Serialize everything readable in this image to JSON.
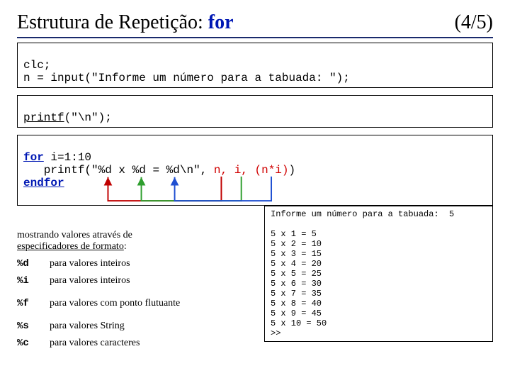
{
  "header": {
    "title_pre": "Estrutura de Repetição: ",
    "title_kw": "for",
    "pager": "(4/5)"
  },
  "code1": {
    "line1": "clc;",
    "line2": "n = input(\"Informe um número para a tabuada: \");"
  },
  "code2": {
    "line1a": "printf",
    "line1b": "(\"\\n\");"
  },
  "code3": {
    "kw_for": "for",
    "for_rest": " i=1:10",
    "pf1": "   printf(",
    "fmt_q1": "\"",
    "fmt_d1": "%d",
    "fmt_x": " x ",
    "fmt_d2": "%d",
    "fmt_eq": " = ",
    "fmt_d3": "%d",
    "fmt_tail": "\\n\"",
    "comma_sp": ", ",
    "arg_n": "n,",
    "sp": " ",
    "arg_i": "i,",
    "arg_ni": "(n*i)",
    "pf_close": ")",
    "kw_end": "endfor"
  },
  "notes": {
    "intro1": "mostrando valores através de",
    "intro2": "especificadores de formato",
    "colon": ":",
    "d": "%d",
    "d_desc": "para valores inteiros",
    "i": "%i",
    "i_desc": "para valores inteiros",
    "f": "%f",
    "f_desc": "para valores com ponto flutuante",
    "s": "%s",
    "s_desc": "para valores String",
    "c": "%c",
    "c_desc": "para valores caracteres"
  },
  "output": {
    "prompt": "Informe um número para a tabuada:  5",
    "lines": [
      "5 x 1 = 5",
      "5 x 2 = 10",
      "5 x 3 = 15",
      "5 x 4 = 20",
      "5 x 5 = 25",
      "5 x 6 = 30",
      "5 x 7 = 35",
      "5 x 8 = 40",
      "5 x 9 = 45",
      "5 x 10 = 50"
    ],
    "cursor": ">>"
  }
}
